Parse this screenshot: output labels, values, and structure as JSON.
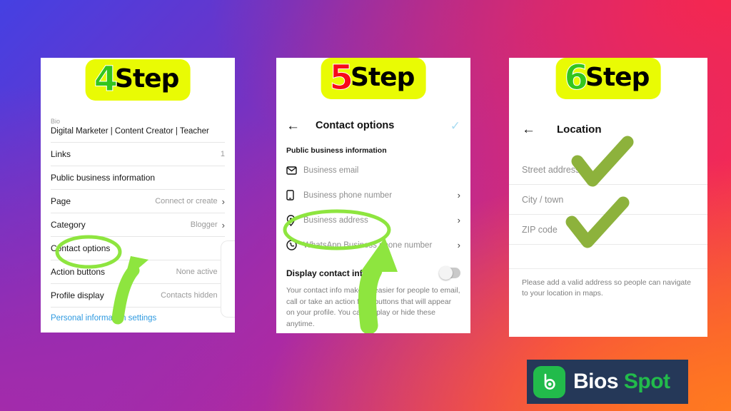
{
  "background": {
    "gradient_colors": [
      "#4540e2",
      "#6b34c9",
      "#b12a9e",
      "#ef2b5d",
      "#f9512f"
    ]
  },
  "accents": {
    "badge_bg": "#e9fb04",
    "step4_num_color": "#33c61d",
    "step5_num_color": "#f70a1a",
    "step6_num_color": "#33c61d",
    "marker_green": "#8ee53f",
    "checkmark_green": "#8db23c",
    "link_blue": "#2f9ae0",
    "logo_green": "#22bb4b",
    "logo_navy": "#253858"
  },
  "panel1": {
    "badge": {
      "number": "4",
      "word": "Step"
    },
    "bio_label": "Bio",
    "bio_value": "Digital Marketer | Content Creator | Teacher",
    "rows": [
      {
        "label": "Links",
        "meta": "1",
        "chevron": false
      },
      {
        "label": "Public business information",
        "meta": "",
        "chevron": false
      },
      {
        "label": "Page",
        "meta": "Connect or create",
        "chevron": true
      },
      {
        "label": "Category",
        "meta": "Blogger",
        "chevron": true
      },
      {
        "label": "Contact options",
        "meta": "",
        "chevron": true
      },
      {
        "label": "Action buttons",
        "meta": "None active",
        "chevron": true
      },
      {
        "label": "Profile display",
        "meta": "Contacts hidden",
        "chevron": true
      }
    ],
    "link_row": "Personal information settings",
    "annotation": {
      "circled_item": "Contact options",
      "arrow": "up"
    }
  },
  "panel2": {
    "badge": {
      "number": "5",
      "word": "Step"
    },
    "appbar": {
      "back_icon": "arrow-left-icon",
      "title": "Contact options",
      "confirm_icon": "check-icon"
    },
    "section_heading": "Public business information",
    "contact_rows": [
      {
        "icon": "envelope-icon",
        "label": "Business email",
        "chevron": false
      },
      {
        "icon": "phone-icon",
        "label": "Business phone number",
        "chevron": true
      },
      {
        "icon": "location-pin-icon",
        "label": "Business address",
        "chevron": true
      },
      {
        "icon": "whatsapp-icon",
        "label": "WhatsApp Business phone number",
        "chevron": true
      }
    ],
    "toggle": {
      "label": "Display contact info",
      "state": "off"
    },
    "help_text": "Your contact info makes it easier for people to email, call or take an action from buttons that will appear on your profile. You can display or hide these anytime.",
    "annotation": {
      "circled_item": "Business address",
      "arrow": "up"
    }
  },
  "panel3": {
    "badge": {
      "number": "6",
      "word": "Step"
    },
    "appbar": {
      "back_icon": "arrow-left-icon",
      "title": "Location"
    },
    "fields": [
      {
        "placeholder": "Street address",
        "value": ""
      },
      {
        "placeholder": "City / town",
        "value": ""
      },
      {
        "placeholder": "ZIP code",
        "value": ""
      }
    ],
    "note": "Please add a valid address so people can navigate to your location in maps.",
    "annotation": {
      "checkmarks": 2
    }
  },
  "logo": {
    "mark_icon": "bios-spot-b-icon",
    "word1": "Bios",
    "word2": "Spot"
  }
}
